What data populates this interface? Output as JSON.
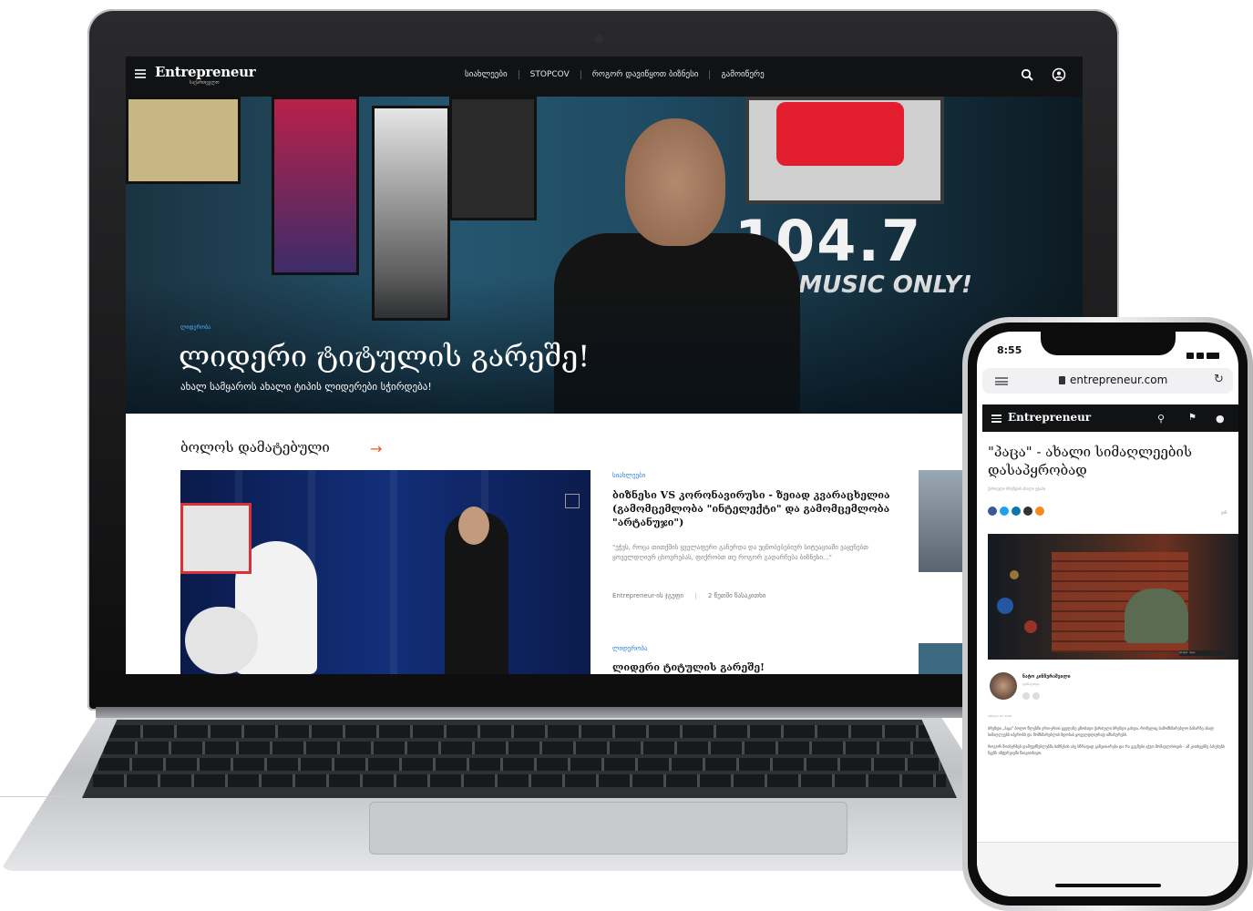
{
  "site": {
    "logo": "Entrepreneur",
    "logo_sub": "საქართველო",
    "nav": [
      "სიახლეები",
      "STOPCOV",
      "როგორ დავიწყოთ ბიზნესი",
      "გამოიწერე"
    ]
  },
  "hero": {
    "category": "ლიდერობა",
    "title": "ლიდერი ტიტულის გარეშე!",
    "subtitle": "ახალ სამყაროს ახალი ტიპის ლიდერები სჭირდება!",
    "sign_number": "104.7",
    "sign_text": "HIT MUSIC ONLY!"
  },
  "latest": {
    "heading": "ბოლოს დამატებული",
    "articles": [
      {
        "category": "სიახლეები",
        "title": "ბიზნესი VS კორონავირუსი - ზეიად კვარაცხელია (გამომცემლობა \"ინტელექტი\" და გამომცემლობა \"არტანუჯი\")",
        "description": "\"ეჭვს, როცა თითქმის ყველაფერი გაჩერდა და უცნობებებიურ სიტუაციაში ვაყენებთ ყოველდღიურ ცხოვრებას, ფიქრობთ თუ როგორ გადარჩება ბიზნესი...\"",
        "author": "Entrepreneur-ის ჯგუფი",
        "time": "2 წუთში წასაკითხი"
      },
      {
        "category": "ლიდერობა",
        "title": "ლიდერი ტიტულის გარეშე!"
      }
    ]
  },
  "phone": {
    "time": "8:55",
    "url": "entrepreneur.com",
    "logo": "Entrepreneur",
    "article_title": "\"პაცა\" - ახალი სიმაღლეების დასაპყრობად",
    "article_sub": "ქართული ბრენდის ახალი ეტაპი",
    "share_label": "გაზ.",
    "image_caption": "ფოტო: პაცა",
    "author": "ნატო კინწურაშვილი",
    "author_role": "ჟურნალისტი",
    "date": "აპრილი 10, 2020",
    "paragraphs": [
      "ბრენდი „პაცა\" ბოლო წლებში ერთ-ერთი ყველაზე ცნობადი ქართული ბრენდი გახდა, რომელიც სამომხმარებლო ბაზარზე ახალ სიმაღლეებს იპყრობს და მომხმარებლის ნდობას ყოველდღიურად იმსახურებს.",
      "როგორ მოახერხეს დამფუძნებლებმა ბიზნესის ასე სწრაფად განვითარება და რა გეგმები აქვთ მომავლისთვის - ამ კითხვებზე პასუხებს ჩვენს ინტერვიუში წაიკითხავთ."
    ]
  }
}
